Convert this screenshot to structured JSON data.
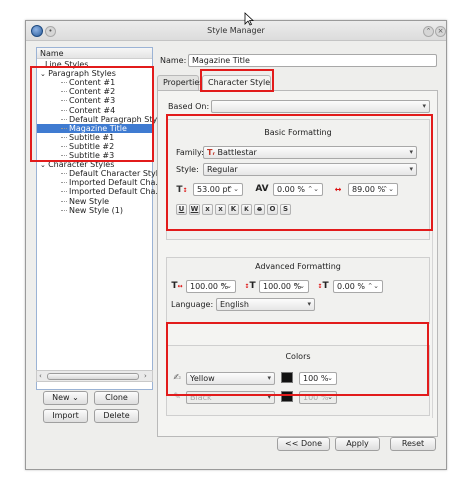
{
  "window": {
    "title": "Style Manager"
  },
  "tree": {
    "header": "Name",
    "rows": [
      {
        "label": "Line Styles",
        "indent": 1,
        "marker": ""
      },
      {
        "label": "Paragraph Styles",
        "indent": 0,
        "marker": "⌄"
      },
      {
        "label": "Content #1",
        "indent": 2,
        "marker": ""
      },
      {
        "label": "Content #2",
        "indent": 2,
        "marker": ""
      },
      {
        "label": "Content #3",
        "indent": 2,
        "marker": ""
      },
      {
        "label": "Content #4",
        "indent": 2,
        "marker": ""
      },
      {
        "label": "Default Paragraph Style",
        "indent": 2,
        "marker": ""
      },
      {
        "label": "Magazine Title",
        "indent": 2,
        "marker": "",
        "selected": true
      },
      {
        "label": "Subtitle #1",
        "indent": 2,
        "marker": ""
      },
      {
        "label": "Subtitle #2",
        "indent": 2,
        "marker": ""
      },
      {
        "label": "Subtitle #3",
        "indent": 2,
        "marker": ""
      },
      {
        "label": "Character Styles",
        "indent": 0,
        "marker": "⌄"
      },
      {
        "label": "Default Character Style",
        "indent": 2,
        "marker": ""
      },
      {
        "label": "Imported Default Cha...",
        "indent": 2,
        "marker": ""
      },
      {
        "label": "Imported Default Cha...",
        "indent": 2,
        "marker": ""
      },
      {
        "label": "New Style",
        "indent": 2,
        "marker": ""
      },
      {
        "label": "New Style (1)",
        "indent": 2,
        "marker": ""
      }
    ]
  },
  "left_buttons": {
    "new": "New",
    "clone": "Clone",
    "import": "Import",
    "delete": "Delete"
  },
  "name_field": {
    "label": "Name:",
    "value": "Magazine Title"
  },
  "tabs": {
    "properties": "Properties",
    "character_style": "Character Style"
  },
  "based_on": {
    "label": "Based On:",
    "value": ""
  },
  "basic_formatting": {
    "title": "Basic Formatting",
    "family_label": "Family:",
    "family_value": "Battlestar",
    "family_icon": "Tᵣ",
    "style_label": "Style:",
    "style_value": "Regular",
    "font_size": "53.00 pt",
    "tracking": "0.00 %",
    "scaling": "89.00 %",
    "effect_buttons": [
      "U",
      "W",
      "x",
      "x",
      "K",
      "K",
      "e",
      "O",
      "S"
    ]
  },
  "advanced_formatting": {
    "title": "Advanced Formatting",
    "horizontal_scale": "100.00 %",
    "vertical_scale": "100.00 %",
    "baseline_offset": "0.00 %",
    "language_label": "Language:",
    "language_value": "English"
  },
  "colors": {
    "title": "Colors",
    "fill_color": "Yellow",
    "fill_shade": "100 %",
    "stroke_color": "Black",
    "stroke_shade": "100 %"
  },
  "bottom_buttons": {
    "done": "<< Done",
    "apply": "Apply",
    "reset": "Reset"
  },
  "accent": {
    "highlight": "#e21b1b",
    "selection": "#3f7bd1"
  }
}
